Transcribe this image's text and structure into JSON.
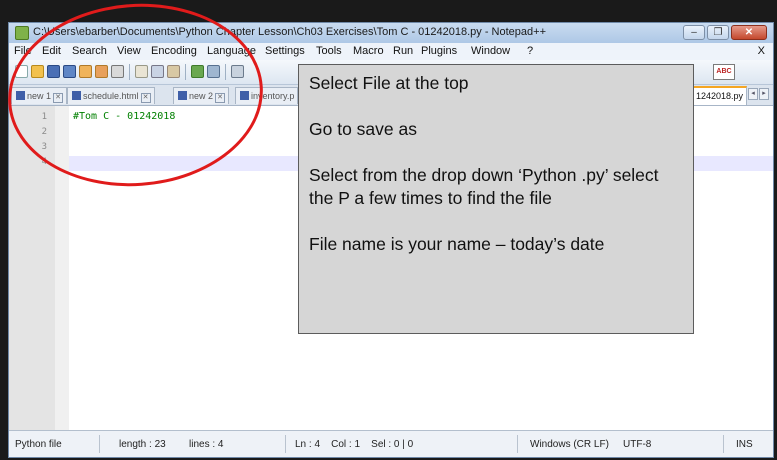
{
  "window": {
    "title": "C:\\Users\\ebarber\\Documents\\Python Chapter Lesson\\Ch03 Exercises\\Tom C - 01242018.py - Notepad++",
    "controls": {
      "minimize": "–",
      "maximize": "❐",
      "close": "✕"
    }
  },
  "menubar": {
    "items": [
      "File",
      "Edit",
      "Search",
      "View",
      "Encoding",
      "Language",
      "Settings",
      "Tools",
      "Macro",
      "Run",
      "Plugins",
      "Window",
      "?"
    ],
    "close_x": "X"
  },
  "toolbar": {
    "spell_check_label": "ABC"
  },
  "tabs": [
    {
      "label": "new 1"
    },
    {
      "label": "schedule.html"
    },
    {
      "label": "new 2"
    },
    {
      "label": "inventory.p"
    },
    {
      "label": "1242018.py",
      "active": true
    }
  ],
  "tab_arrows": {
    "left": "◂",
    "right": "▸"
  },
  "editor": {
    "line_numbers": [
      "1",
      "2",
      "3",
      "4"
    ],
    "lines": [
      "#Tom C - 01242018",
      "",
      "",
      ""
    ],
    "current_line": 4
  },
  "statusbar": {
    "filetype": "Python file",
    "length": "length : 23",
    "lines": "lines : 4",
    "position": "Ln : 4    Col : 1    Sel : 0 | 0",
    "eol": "Windows (CR LF)",
    "encoding": "UTF-8",
    "mode": "INS"
  },
  "callout": {
    "paragraphs": [
      "Select File at the top",
      "Go to save as",
      "Select from the drop down ‘Python .py’ select the P a few times to find the file",
      "File name is your name – today’s date"
    ]
  },
  "colors": {
    "annotation_red": "#e01b1b",
    "comment_green": "#008000",
    "callout_bg": "#d6d6d6"
  }
}
